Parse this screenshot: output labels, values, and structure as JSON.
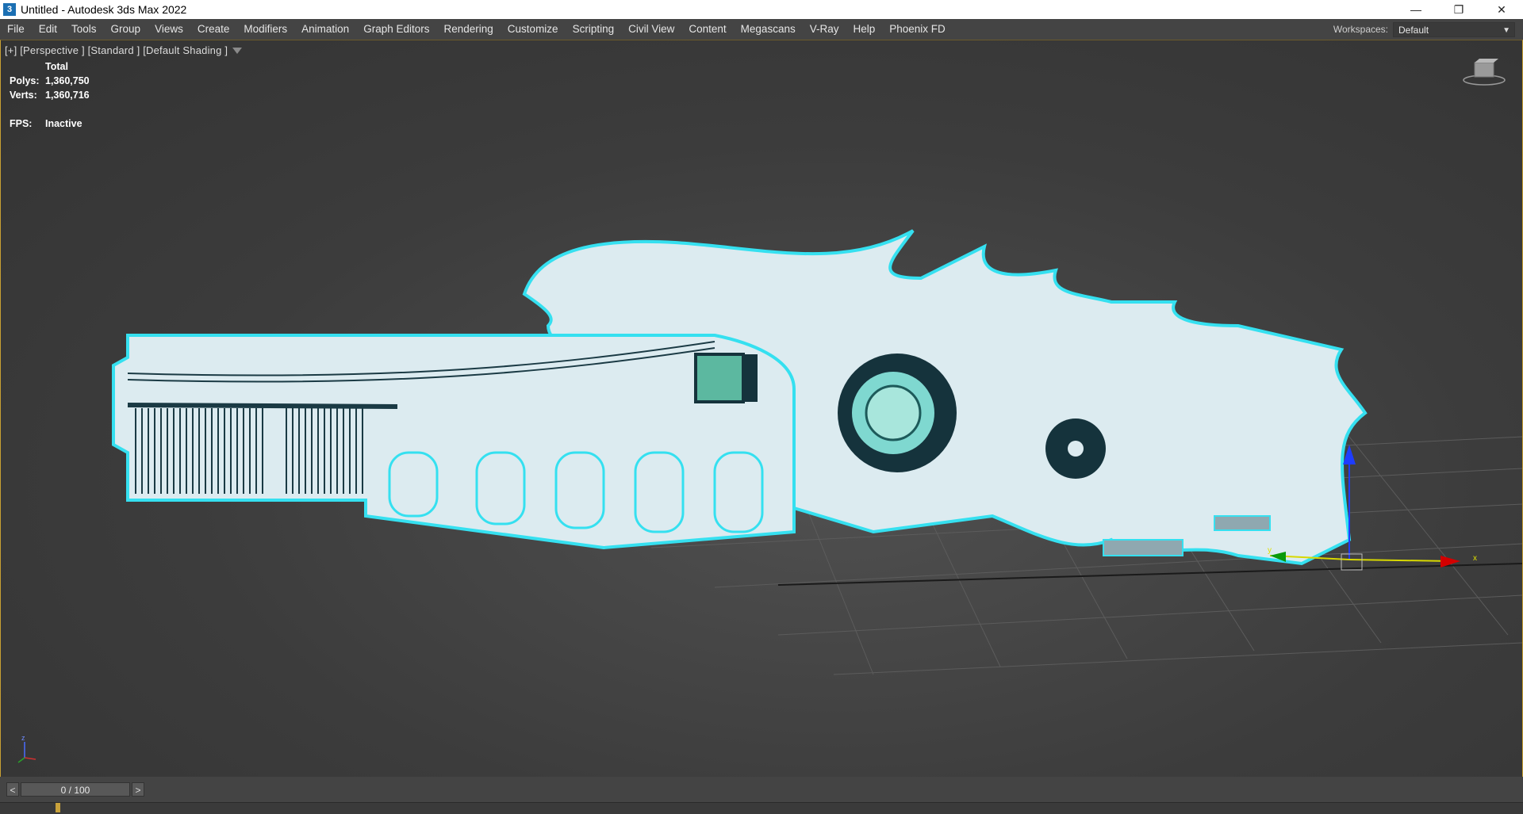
{
  "titlebar": {
    "icon_glyph": "3",
    "title": "Untitled - Autodesk 3ds Max 2022",
    "minimize": "—",
    "restore": "❐",
    "close": "✕"
  },
  "menu": {
    "items": [
      "File",
      "Edit",
      "Tools",
      "Group",
      "Views",
      "Create",
      "Modifiers",
      "Animation",
      "Graph Editors",
      "Rendering",
      "Customize",
      "Scripting",
      "Civil View",
      "Content",
      "Megascans",
      "V-Ray",
      "Help",
      "Phoenix FD"
    ],
    "workspaces_label": "Workspaces:",
    "workspaces_value": "Default"
  },
  "viewport": {
    "label": "[+] [Perspective ] [Standard ] [Default Shading ]",
    "stats_header": "Total",
    "polys_label": "Polys:",
    "polys_value": "1,360,750",
    "verts_label": "Verts:",
    "verts_value": "1,360,716",
    "fps_label": "FPS:",
    "fps_value": "Inactive",
    "gizmo_x": "x",
    "gizmo_y": "y",
    "tripod_z": "z"
  },
  "timeline": {
    "prev": "<",
    "frame": "0 / 100",
    "next": ">"
  },
  "colors": {
    "selection_outline": "#35e0f0",
    "model_fill": "#dcebf0",
    "accent_frame": "#c8a033"
  }
}
